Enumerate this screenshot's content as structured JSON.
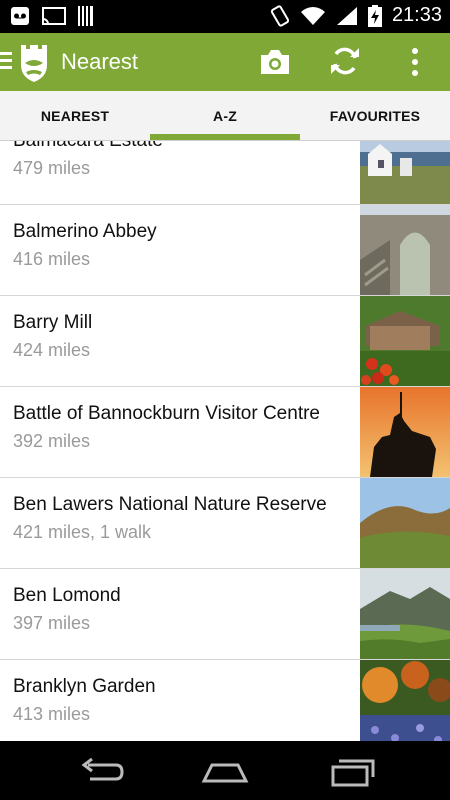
{
  "status_bar": {
    "time": "21:33",
    "left_icons": [
      "voicemail-icon",
      "cast-icon",
      "barcode-icon"
    ],
    "right_icons": [
      "phone-vibrate-icon",
      "wifi-icon",
      "signal-icon",
      "battery-charging-icon"
    ]
  },
  "action_bar": {
    "title": "Nearest",
    "accent_color": "#7fa836",
    "actions": [
      "camera-icon",
      "refresh-icon",
      "overflow-menu-icon"
    ]
  },
  "tabs": [
    {
      "label": "NEAREST",
      "selected": false
    },
    {
      "label": "A-Z",
      "selected": true
    },
    {
      "label": "FAVOURITES",
      "selected": false
    }
  ],
  "places": [
    {
      "name": "Balmacara Estate",
      "distance": "479 miles"
    },
    {
      "name": "Balmerino Abbey",
      "distance": "416 miles"
    },
    {
      "name": "Barry Mill",
      "distance": "424 miles"
    },
    {
      "name": "Battle of Bannockburn Visitor Centre",
      "distance": "392 miles"
    },
    {
      "name": "Ben Lawers National Nature Reserve",
      "distance": "421 miles, 1 walk"
    },
    {
      "name": "Ben Lomond",
      "distance": "397 miles"
    },
    {
      "name": "Branklyn Garden",
      "distance": "413 miles"
    }
  ],
  "nav_bar": [
    "back-icon",
    "home-icon",
    "recent-apps-icon"
  ]
}
